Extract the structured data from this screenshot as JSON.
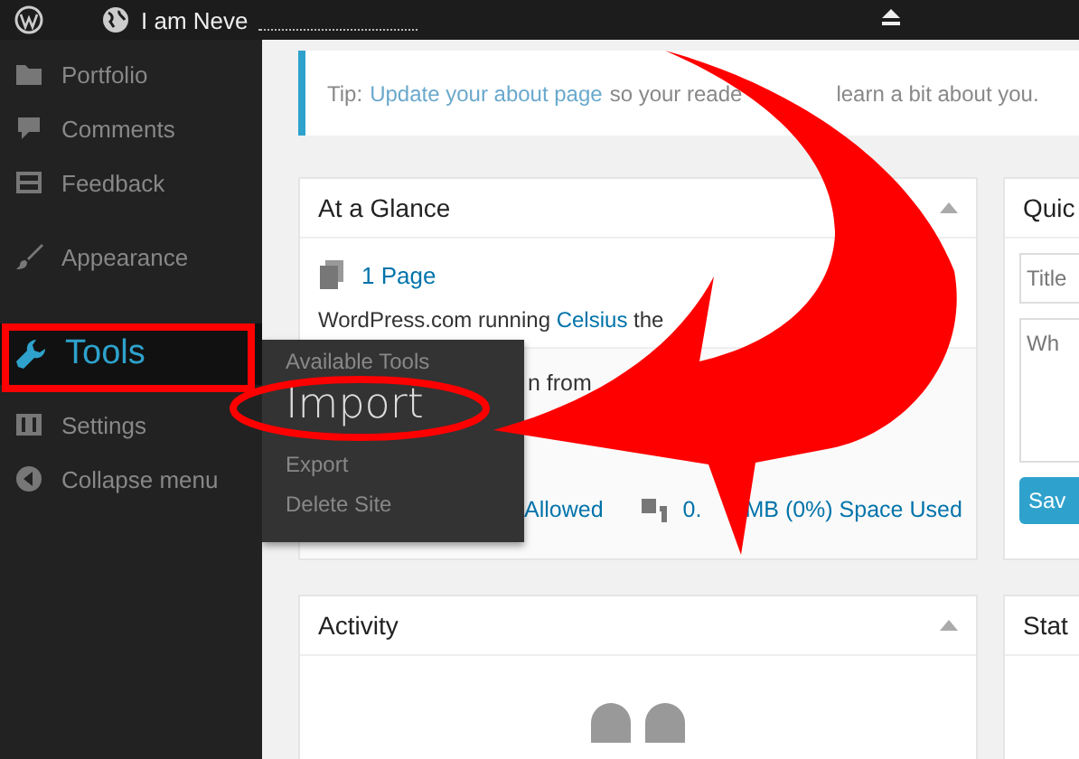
{
  "top_bar": {
    "site_name": "I am Neve"
  },
  "sidebar": {
    "items": [
      {
        "label": "Portfolio",
        "selected": false
      },
      {
        "label": "Comments",
        "selected": false
      },
      {
        "label": "Feedback",
        "selected": false
      },
      {
        "label": "Appearance",
        "selected": false
      },
      {
        "label": "Tools",
        "selected": true
      },
      {
        "label": "Settings",
        "selected": false
      },
      {
        "label": "Collapse menu",
        "selected": false
      }
    ]
  },
  "tools_menu": {
    "items": [
      {
        "label": "Available Tools",
        "selected": false
      },
      {
        "label": "Import",
        "selected": true
      },
      {
        "label": "Export",
        "selected": false
      },
      {
        "label": "Delete Site",
        "selected": false
      }
    ]
  },
  "tip": {
    "prefix": "Tip:",
    "link": "Update your about page",
    "text_before_arrow": "so your reade",
    "text_after_arrow": "learn a bit about you."
  },
  "at_a_glance": {
    "title": "At a Glance",
    "pages": "1 Page",
    "theme_text": "WordPress.com running",
    "theme_link": "Celsius",
    "theme_suffix": "the",
    "import_text": "n from",
    "uploads": "Allowed",
    "space_start": "0.",
    "space_end": "MB (0%) Space Used"
  },
  "quick_draft": {
    "title": "Quic",
    "title_placeholder": "Title",
    "content_placeholder": "Wh",
    "button": "Sav"
  },
  "activity": {
    "title": "Activity"
  },
  "stats": {
    "title": "Stat"
  }
}
